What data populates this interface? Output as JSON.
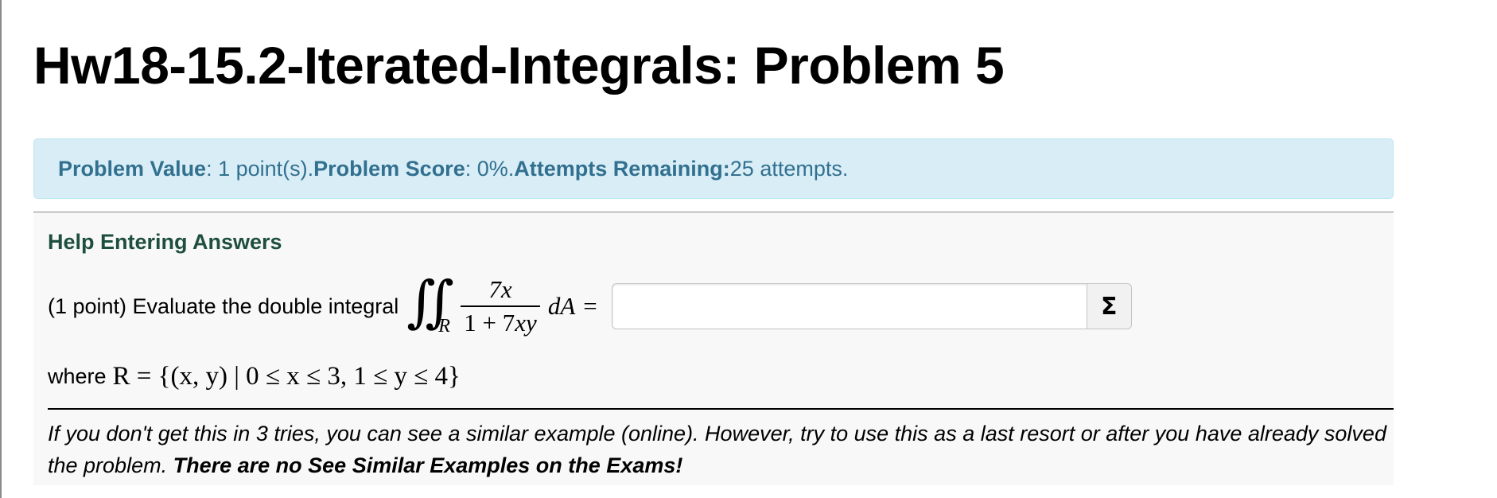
{
  "page": {
    "title": "Hw18-15.2-Iterated-Integrals: Problem 5"
  },
  "info": {
    "value_label": "Problem Value",
    "value_text": ": 1 point(s). ",
    "score_label": "Problem Score",
    "score_text": ": 0%. ",
    "attempts_label": "Attempts Remaining:",
    "attempts_text": " 25 attempts."
  },
  "problem": {
    "help_link": "Help Entering Answers",
    "prompt": "(1 point) Evaluate the double integral",
    "integral_symbol": "∬",
    "region": "R",
    "numerator": "7x",
    "denominator_prefix": "1 + 7",
    "denominator_var": "xy",
    "differential": "dA",
    "equals": "=",
    "answer_value": "",
    "equation_button": "Σ",
    "where_label": "where",
    "region_definition": "R = {(x, y) | 0 ≤ x ≤ 3,  1 ≤ y ≤ 4}"
  },
  "note": {
    "text": "If you don't get this in 3 tries, you can see a similar example (online). However, try to use this as a last resort or after you have already solved the problem. ",
    "emphasis": "There are no See Similar Examples on the Exams!"
  },
  "colors": {
    "info_bg": "#d9edf7",
    "info_text": "#31708f",
    "help_link": "#1e4f3e"
  }
}
